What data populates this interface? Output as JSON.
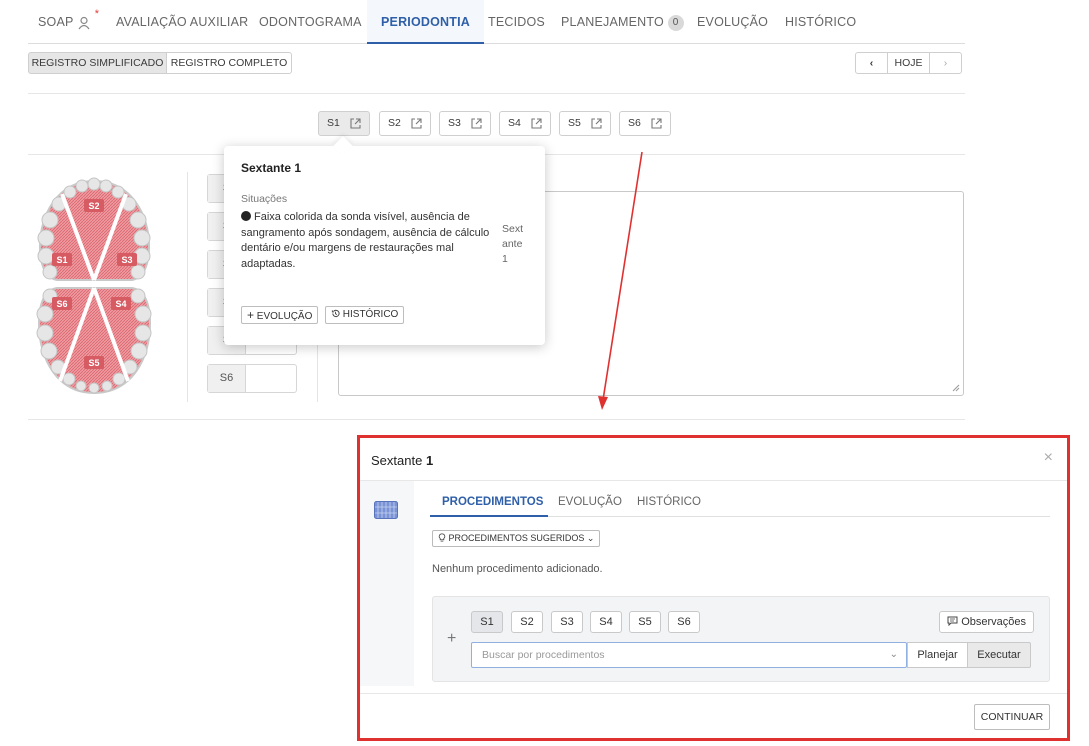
{
  "tabs": [
    {
      "label": "SOAP"
    },
    {
      "label": "AVALIAÇÃO AUXILIAR"
    },
    {
      "label": "ODONTOGRAMA"
    },
    {
      "label": "PERIODONTIA"
    },
    {
      "label": "TECIDOS"
    },
    {
      "label": "PLANEJAMENTO",
      "badge": "0"
    },
    {
      "label": "EVOLUÇÃO"
    },
    {
      "label": "HISTÓRICO"
    }
  ],
  "soap_marker": "*",
  "mode": {
    "simple": "REGISTRO SIMPLIFICADO",
    "full": "REGISTRO COMPLETO"
  },
  "nav": {
    "prev": "‹",
    "today": "HOJE",
    "next": "›"
  },
  "sextants": [
    "S1",
    "S2",
    "S3",
    "S4",
    "S5",
    "S6"
  ],
  "side_rows": [
    "S",
    "S",
    "S",
    "S",
    "S",
    "S6"
  ],
  "chart_labels": [
    "S2",
    "S1",
    "S3",
    "S6",
    "S4",
    "S5"
  ],
  "popover": {
    "title": "Sextante 1",
    "subtitle": "Situações",
    "text": "Faixa colorida da sonda visível, ausência de sangramento após sondagem, ausência de cálculo dentário e/ou margens de restaurações mal adaptadas.",
    "side": "Sextante 1",
    "btn_evolucao": "EVOLUÇÃO",
    "btn_historico": "HISTÓRICO"
  },
  "modal": {
    "title_prefix": "Sextante ",
    "title_number": "1",
    "close": "×",
    "tabs": [
      "PROCEDIMENTOS",
      "EVOLUÇÃO",
      "HISTÓRICO"
    ],
    "suggested": "PROCEDIMENTOS SUGERIDOS",
    "empty": "Nenhum procedimento adicionado.",
    "chips": [
      "S1",
      "S2",
      "S3",
      "S4",
      "S5",
      "S6"
    ],
    "observacoes": "Observações",
    "search_placeholder": "Buscar por procedimentos",
    "plan": "Planejar",
    "execute": "Executar",
    "continue": "CONTINUAR"
  },
  "colors": {
    "accent": "#2e5fa8",
    "annotation": "#e03131",
    "tooth_fill": "#e88f95"
  }
}
